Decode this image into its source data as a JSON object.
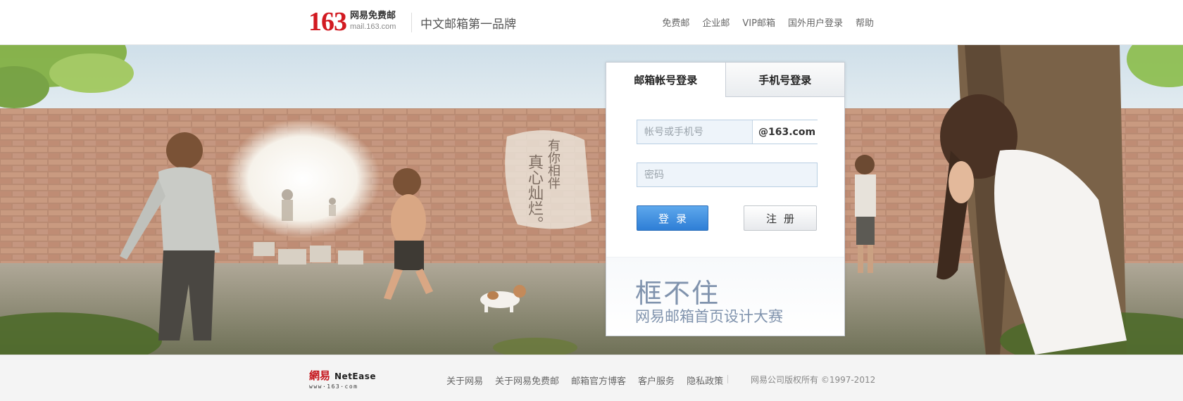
{
  "header": {
    "logo_number": "163",
    "logo_cn": "网易免费邮",
    "logo_url": "mail.163.com",
    "slogan": "中文邮箱第一品牌",
    "nav": [
      "免费邮",
      "企业邮",
      "VIP邮箱",
      "国外用户登录",
      "帮助"
    ]
  },
  "banner": {
    "poem_col1": "有你相伴",
    "poem_col2": "真心灿烂。"
  },
  "login": {
    "tab_account": "邮箱帐号登录",
    "tab_phone": "手机号登录",
    "username_placeholder": "帐号或手机号",
    "domain_suffix": "@163.com",
    "password_placeholder": "密码",
    "login_button": "登录",
    "register_button": "注册",
    "promo_title": "框不住",
    "promo_subtitle": "网易邮箱首页设计大赛"
  },
  "footer": {
    "logo_cn": "網易",
    "logo_en": "NetEase",
    "logo_url": "www·163·com",
    "links": [
      "关于网易",
      "关于网易免费邮",
      "邮箱官方博客",
      "客户服务",
      "隐私政策"
    ],
    "copyright": "网易公司版权所有 ©1997-2012"
  },
  "colors": {
    "brand_red": "#d21a21",
    "login_blue": "#2e7ed6",
    "promo_text": "#8093ad"
  }
}
